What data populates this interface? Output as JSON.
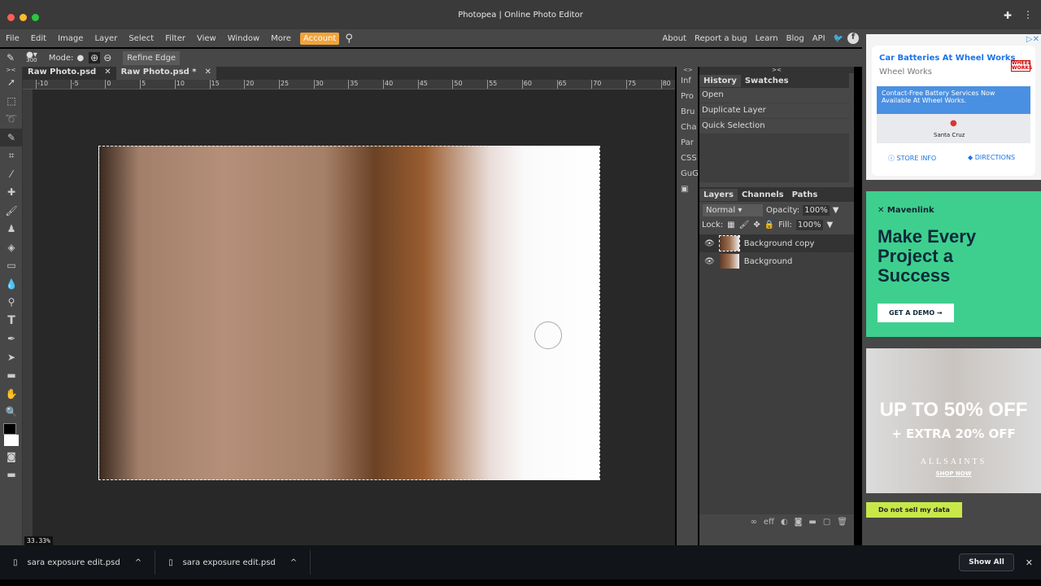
{
  "window": {
    "title": "Photopea | Online Photo Editor"
  },
  "menu": {
    "items": [
      "File",
      "Edit",
      "Image",
      "Layer",
      "Select",
      "Filter",
      "View",
      "Window",
      "More"
    ],
    "account": "Account",
    "links": [
      "About",
      "Report a bug",
      "Learn",
      "Blog",
      "API"
    ]
  },
  "options": {
    "brush_size": "300",
    "mode_label": "Mode:",
    "refine_edge": "Refine Edge"
  },
  "tabs": [
    {
      "label": "Raw Photo.psd"
    },
    {
      "label": "Raw Photo.psd *"
    }
  ],
  "ruler": {
    "labels": [
      "-10",
      "-5",
      "0",
      "5",
      "10",
      "15",
      "20",
      "25",
      "30",
      "35",
      "40",
      "45",
      "50",
      "55",
      "60",
      "65",
      "70",
      "75",
      "80"
    ]
  },
  "zoom_level": "33.33%",
  "mini_panel": [
    "Inf",
    "Pro",
    "Bru",
    "Cha",
    "Par",
    "CSS",
    "GuG"
  ],
  "history": {
    "tabs": [
      "History",
      "Swatches"
    ],
    "items": [
      "Open",
      "Duplicate Layer",
      "Quick Selection"
    ]
  },
  "layers": {
    "tabs": [
      "Layers",
      "Channels",
      "Paths"
    ],
    "blend_mode": "Normal",
    "opacity_label": "Opacity:",
    "opacity": "100%",
    "lock_label": "Lock:",
    "fill_label": "Fill:",
    "fill": "100%",
    "items": [
      "Background copy",
      "Background"
    ],
    "footer_eff": "eff"
  },
  "ads": {
    "ad1": {
      "title": "Car Batteries At Wheel Works",
      "advertiser": "Wheel Works",
      "logo": "WHEEL WORKS",
      "banner": "Contact-Free Battery Services Now Available At Wheel Works.",
      "map_label": "Santa Cruz",
      "store_info": "STORE INFO",
      "directions": "DIRECTIONS"
    },
    "ad2": {
      "brand": "Mavenlink",
      "headline": "Make Every Project a Success",
      "cta": "GET A DEMO →"
    },
    "ad3": {
      "headline": "UP TO 50% OFF",
      "sub": "+ EXTRA 20% OFF",
      "brand": "ALLSAINTS",
      "cta": "SHOP NOW"
    },
    "dnsmd": "Do not sell my data"
  },
  "downloads": {
    "items": [
      "sara exposure edit.psd",
      "sara exposure edit.psd"
    ],
    "show_all": "Show All"
  },
  "colors": {
    "accent": "#f2a33a",
    "mavenlink": "#3ecf8e"
  }
}
